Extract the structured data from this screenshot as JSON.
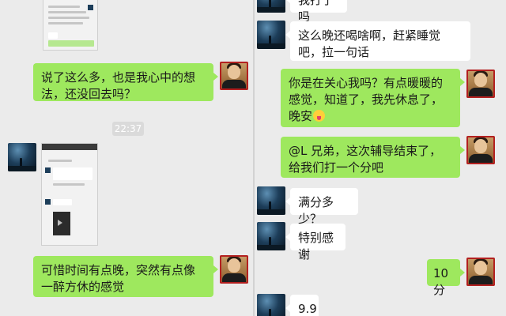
{
  "left": {
    "messages": [
      {
        "text": "说了这么多，也是我心中的想法，还没回去吗？"
      },
      {
        "text": "可惜时间有点晚，突然有点像一醉方休的感觉"
      }
    ],
    "timestamp": "22:37",
    "screenshot_top_tab": "转"
  },
  "right": {
    "messages": [
      {
        "text": "我打了吗"
      },
      {
        "text": "这么晚还喝啥啊，赶紧睡觉吧，拉一句话"
      },
      {
        "text": "你是在关心我吗？有点暖暖的感觉，知道了，我先休息了，晚安"
      },
      {
        "text": "@L  兄弟，这次辅导结束了，给我们打一个分吧"
      },
      {
        "text": "满分多少？"
      },
      {
        "text": "特别感谢"
      },
      {
        "text": "10分"
      },
      {
        "text": "9.9"
      }
    ],
    "emoji_icon": "grinning-face-tongue"
  },
  "colors": {
    "green_bubble": "#9ee85e",
    "white_bubble": "#ffffff",
    "chat_bg": "#ebebeb"
  }
}
